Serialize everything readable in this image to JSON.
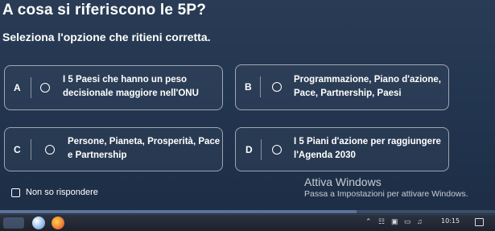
{
  "question": "A cosa si riferiscono le 5P?",
  "instruction": "Seleziona l'opzione che ritieni corretta.",
  "options": [
    {
      "letter": "A",
      "line1": "I 5 Paesi che hanno un peso",
      "line2": "decisionale maggiore nell'ONU"
    },
    {
      "letter": "B",
      "line1": "Programmazione, Piano d'azione,",
      "line2": "Pace, Partnership, Paesi"
    },
    {
      "letter": "C",
      "line1": "Persone, Pianeta, Prosperità, Pace",
      "line2": "e Partnership"
    },
    {
      "letter": "D",
      "line1": "I 5 Piani d'azione per raggiungere",
      "line2": "l'Agenda 2030"
    }
  ],
  "dont_know_label": "Non so rispondere",
  "watermark": {
    "title": "Attiva Windows",
    "subtitle": "Passa a Impostazioni per attivare Windows."
  },
  "progress": {
    "fraction": 0.72
  },
  "taskbar": {
    "time": "10:15",
    "tray_icons": [
      "chevron-up-icon",
      "network-icon",
      "camera-icon",
      "battery-icon",
      "speaker-icon"
    ]
  },
  "colors": {
    "background": "#233650",
    "text": "#ffffff",
    "progress_fill": "#5b7396"
  }
}
